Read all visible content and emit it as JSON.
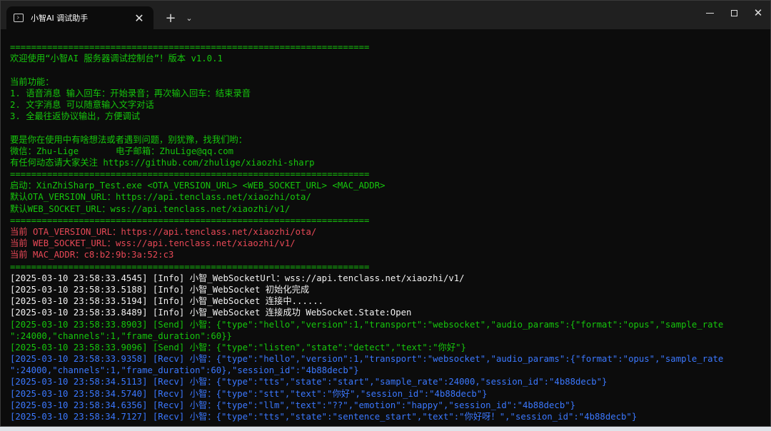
{
  "window": {
    "tab_title": "小智AI 调试助手",
    "tab_close": "✕",
    "new_tab": "+",
    "dropdown": "⌄",
    "close": "✕"
  },
  "terminal": {
    "lines": [
      {
        "text": "====================================================================",
        "color": "green"
      },
      {
        "text": "欢迎使用“小智AI 服务器调试控制台”！版本 v1.0.1",
        "color": "green"
      },
      {
        "text": "",
        "color": "green"
      },
      {
        "text": "当前功能：",
        "color": "green"
      },
      {
        "text": "1. 语音消息 输入回车：开始录音；再次输入回车：结束录音",
        "color": "green"
      },
      {
        "text": "2. 文字消息 可以随意输入文字对话",
        "color": "green"
      },
      {
        "text": "3. 全最往返协议输出，方便调试",
        "color": "green"
      },
      {
        "text": "",
        "color": "green"
      },
      {
        "text": "要是你在使用中有啥想法或者遇到问题，别犹豫，找我们哟：",
        "color": "green"
      },
      {
        "text": "微信：Zhu-Lige       电子邮箱：ZhuLige@qq.com",
        "color": "green"
      },
      {
        "text": "有任何动态请大家关注 https://github.com/zhulige/xiaozhi-sharp",
        "color": "green"
      },
      {
        "text": "====================================================================",
        "color": "green"
      },
      {
        "text": "启动：XinZhiSharp_Test.exe <OTA_VERSION_URL> <WEB_SOCKET_URL> <MAC_ADDR>",
        "color": "green"
      },
      {
        "text": "默认OTA_VERSION_URL：https://api.tenclass.net/xiaozhi/ota/",
        "color": "green"
      },
      {
        "text": "默认WEB_SOCKET_URL：wss://api.tenclass.net/xiaozhi/v1/",
        "color": "green"
      },
      {
        "text": "====================================================================",
        "color": "green"
      },
      {
        "text": "当前 OTA_VERSION_URL：https://api.tenclass.net/xiaozhi/ota/",
        "color": "red"
      },
      {
        "text": "当前 WEB_SOCKET_URL：wss://api.tenclass.net/xiaozhi/v1/",
        "color": "red"
      },
      {
        "text": "当前 MAC_ADDR：c8:b2:9b:3a:52:c3",
        "color": "red"
      },
      {
        "text": "====================================================================",
        "color": "green"
      },
      {
        "text": "[2025-03-10 23:58:33.4545] [Info] 小智_WebSocketUrl：wss://api.tenclass.net/xiaozhi/v1/",
        "color": "white"
      },
      {
        "text": "[2025-03-10 23:58:33.5188] [Info] 小智_WebSocket 初始化完成",
        "color": "white"
      },
      {
        "text": "[2025-03-10 23:58:33.5194] [Info] 小智_WebSocket 连接中......",
        "color": "white"
      },
      {
        "text": "[2025-03-10 23:58:33.8489] [Info] 小智_WebSocket 连接成功 WebSocket.State:Open",
        "color": "white"
      },
      {
        "text": "[2025-03-10 23:58:33.8903] [Send] 小智：{\"type\":\"hello\",\"version\":1,\"transport\":\"websocket\",\"audio_params\":{\"format\":\"opus\",\"sample_rate",
        "color": "green"
      },
      {
        "text": "\":24000,\"channels\":1,\"frame_duration\":60}}",
        "color": "green"
      },
      {
        "text": "[2025-03-10 23:58:33.9096] [Send] 小智：{\"type\":\"listen\",\"state\":\"detect\",\"text\":\"你好\"}",
        "color": "green"
      },
      {
        "text": "[2025-03-10 23:58:33.9358] [Recv] 小智：{\"type\":\"hello\",\"version\":1,\"transport\":\"websocket\",\"audio_params\":{\"format\":\"opus\",\"sample_rate",
        "color": "blue"
      },
      {
        "text": "\":24000,\"channels\":1,\"frame_duration\":60},\"session_id\":\"4b88decb\"}",
        "color": "blue"
      },
      {
        "text": "[2025-03-10 23:58:34.5113] [Recv] 小智：{\"type\":\"tts\",\"state\":\"start\",\"sample_rate\":24000,\"session_id\":\"4b88decb\"}",
        "color": "blue"
      },
      {
        "text": "[2025-03-10 23:58:34.5740] [Recv] 小智：{\"type\":\"stt\",\"text\":\"你好\",\"session_id\":\"4b88decb\"}",
        "color": "blue"
      },
      {
        "text": "[2025-03-10 23:58:34.6356] [Recv] 小智：{\"type\":\"llm\",\"text\":\"??\",\"emotion\":\"happy\",\"session_id\":\"4b88decb\"}",
        "color": "blue"
      },
      {
        "text": "[2025-03-10 23:58:34.7127] [Recv] 小智：{\"type\":\"tts\",\"state\":\"sentence_start\",\"text\":\"你好呀！\",\"session_id\":\"4b88decb\"}",
        "color": "blue"
      }
    ]
  }
}
